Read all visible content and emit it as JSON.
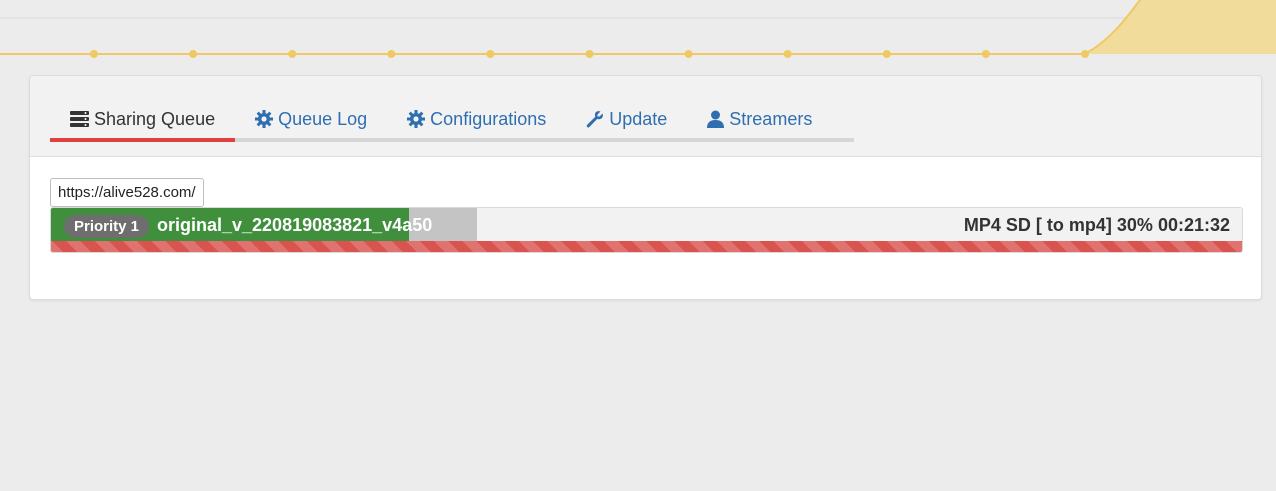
{
  "chart": {
    "line_color": "#f0c864",
    "fill_color": "#f2dc9c",
    "gridline_color": "#d8d8d8"
  },
  "tabs": [
    {
      "label": "Sharing Queue",
      "icon": "server-icon",
      "active": true
    },
    {
      "label": "Queue Log",
      "icon": "gear-icon",
      "active": false
    },
    {
      "label": "Configurations",
      "icon": "gear-icon",
      "active": false
    },
    {
      "label": "Update",
      "icon": "wrench-icon",
      "active": false
    },
    {
      "label": "Streamers",
      "icon": "user-icon",
      "active": false
    }
  ],
  "queue": {
    "url": "https://alive528.com/",
    "job": {
      "priority_label": "Priority 1",
      "filename": "original_v_220819083821_v4a50",
      "status": "MP4 SD [ to mp4] 30% 00:21:32",
      "progress_percent": 30
    }
  },
  "colors": {
    "accent_active_tab": "#e0403f",
    "link": "#2f6fb0",
    "progress_green": "#3f8f3c",
    "progress_gray": "#c4c4c4",
    "stripe_red": "#d9534f"
  }
}
